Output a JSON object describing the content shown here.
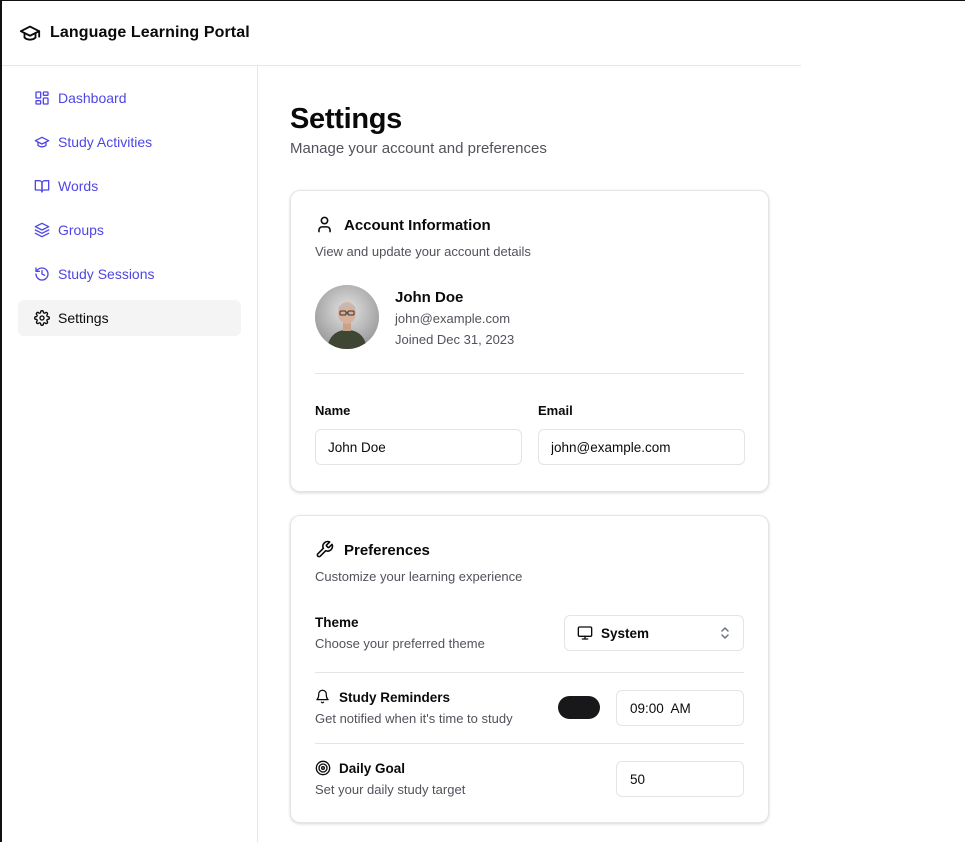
{
  "app": {
    "title": "Language Learning Portal",
    "logo_icon": "graduation-cap-icon"
  },
  "sidebar": {
    "items": [
      {
        "label": "Dashboard",
        "icon": "layout-dashboard-icon",
        "active": false
      },
      {
        "label": "Study Activities",
        "icon": "graduation-cap-icon",
        "active": false
      },
      {
        "label": "Words",
        "icon": "book-open-icon",
        "active": false
      },
      {
        "label": "Groups",
        "icon": "layers-icon",
        "active": false
      },
      {
        "label": "Study Sessions",
        "icon": "history-icon",
        "active": false
      },
      {
        "label": "Settings",
        "icon": "gear-icon",
        "active": true
      }
    ]
  },
  "page": {
    "title": "Settings",
    "subtitle": "Manage your account and preferences"
  },
  "account": {
    "title": "Account Information",
    "description": "View and update your account details",
    "profile": {
      "name": "John Doe",
      "email": "john@example.com",
      "joined": "Joined Dec 31, 2023"
    },
    "fields": {
      "name_label": "Name",
      "name_value": "John Doe",
      "email_label": "Email",
      "email_value": "john@example.com"
    }
  },
  "preferences": {
    "title": "Preferences",
    "description": "Customize your learning experience",
    "theme": {
      "label": "Theme",
      "description": "Choose your preferred theme",
      "selected": "System"
    },
    "reminders": {
      "label": "Study Reminders",
      "description": "Get notified when it's time to study",
      "enabled": true,
      "time": "09:00  AM"
    },
    "goal": {
      "label": "Daily Goal",
      "description": "Set your daily study target",
      "value": "50"
    }
  },
  "colors": {
    "accent": "#4f46e5",
    "active_bg": "#f4f4f5",
    "toggle_on": "#18181b",
    "border": "#e4e4e7"
  }
}
